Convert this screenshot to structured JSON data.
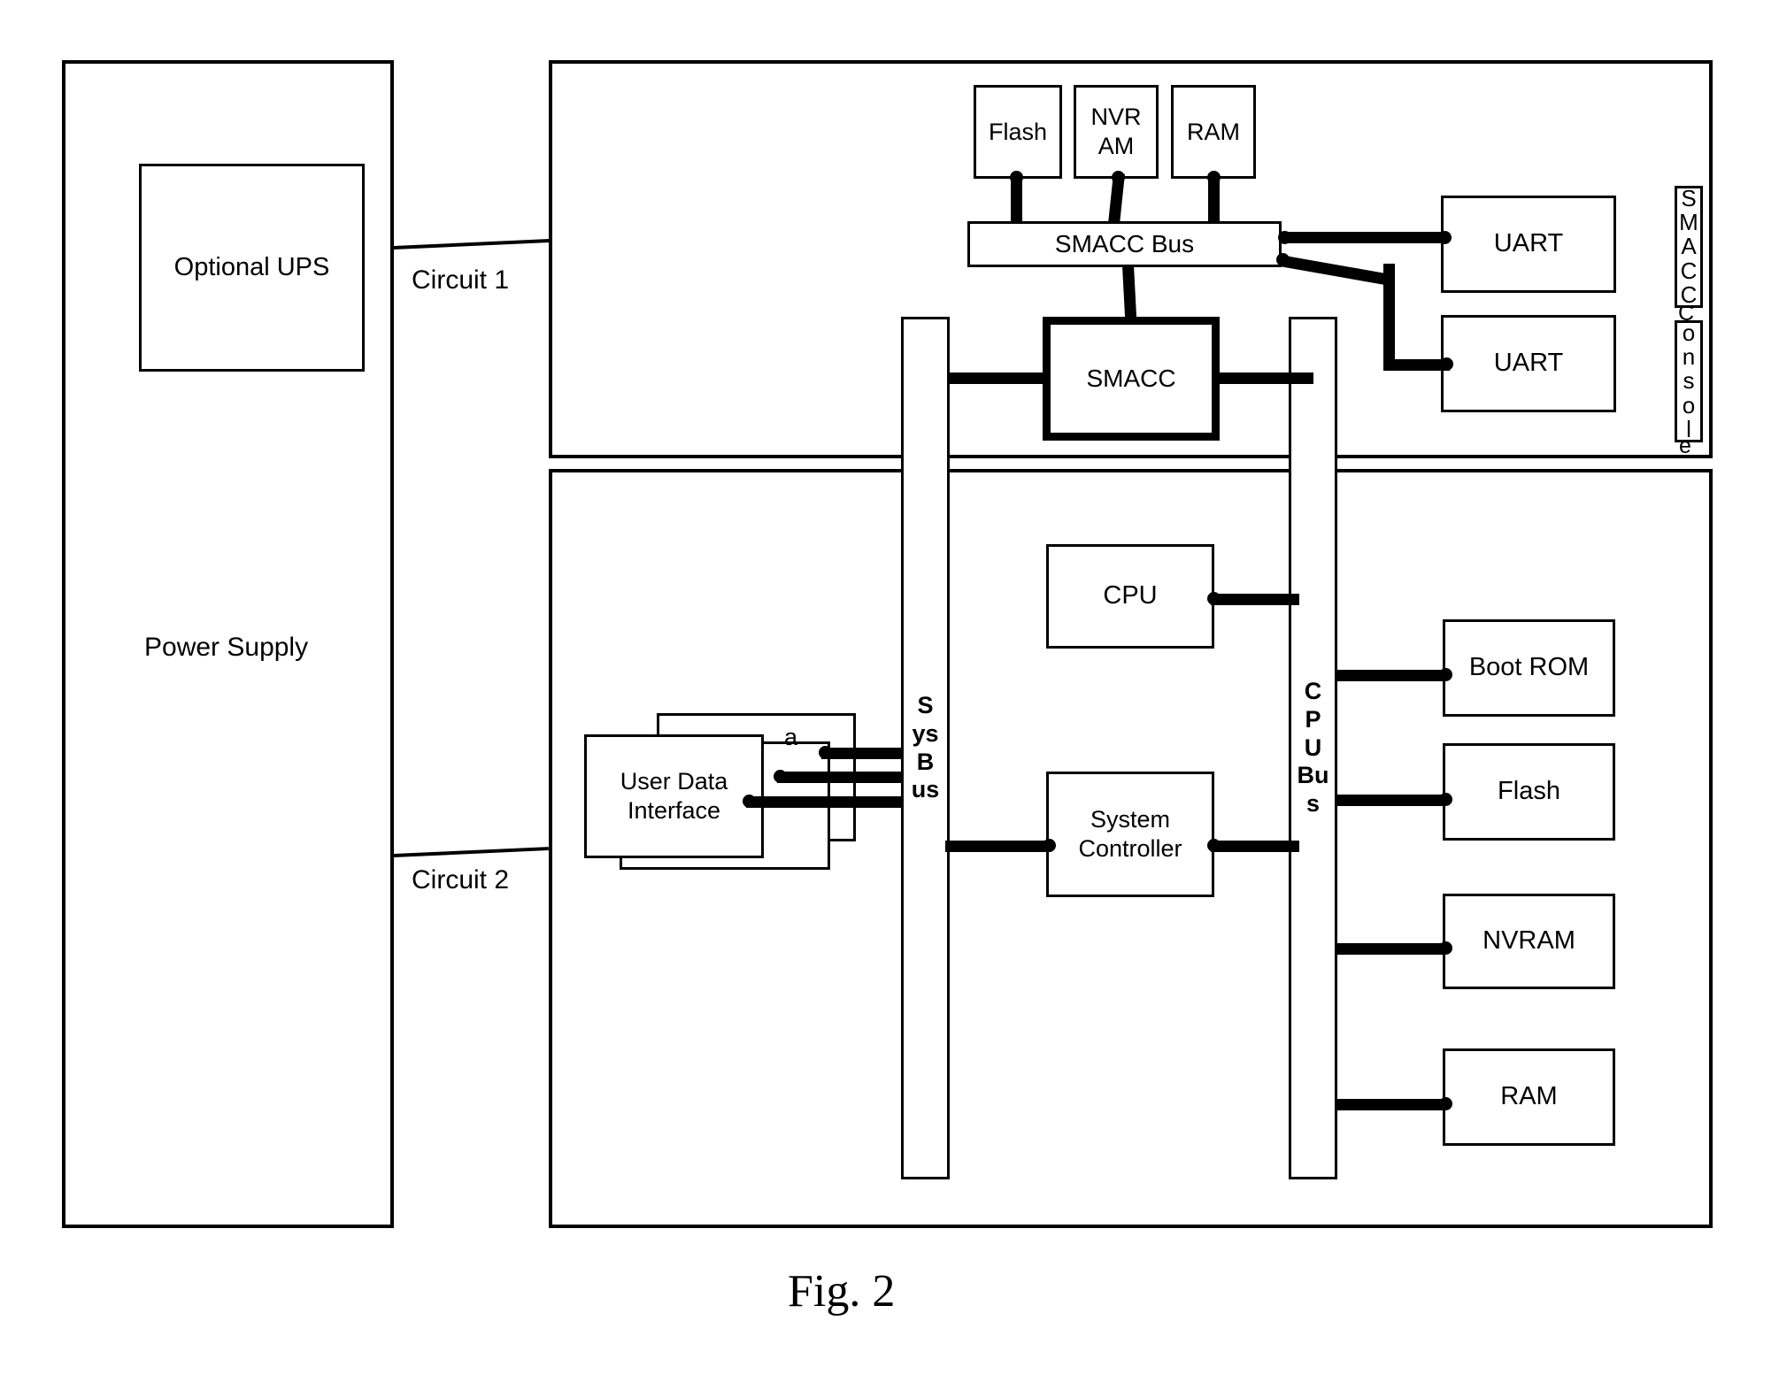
{
  "figure": {
    "caption": "Fig. 2"
  },
  "power_supply": {
    "title": "Power Supply",
    "ups_label": "Optional UPS"
  },
  "connectors": {
    "circuit1_label": "Circuit 1",
    "circuit2_label": "Circuit 2"
  },
  "circuit1": {
    "memories": [
      {
        "label": "Flash"
      },
      {
        "label_line1": "NVR",
        "label_line2": "AM"
      },
      {
        "label": "RAM"
      }
    ],
    "bus_label": "SMACC Bus",
    "controller_label": "SMACC",
    "uarts": [
      {
        "label": "UART"
      },
      {
        "label": "UART"
      }
    ],
    "console_label_part1": [
      "S",
      "M",
      "A",
      "C",
      "C"
    ],
    "console_label_part2": [
      "o",
      "n",
      "s",
      "o",
      "l"
    ],
    "console_overflow_top": "C",
    "console_overflow_bottom": "e",
    "console_full_text": "SMACC Console"
  },
  "circuit2": {
    "user_interface_label_line1": "User Data",
    "user_interface_label_line2": "Interface",
    "hidden_card_letter": "a",
    "sys_bus_label": [
      "S",
      "ys",
      "B",
      "us"
    ],
    "cpu_bus_label": [
      "C",
      "P",
      "U",
      "Bu",
      "s"
    ],
    "cpu_label": "CPU",
    "system_controller_line1": "System",
    "system_controller_line2": "Controller",
    "memories": [
      {
        "label": "Boot ROM"
      },
      {
        "label": "Flash"
      },
      {
        "label": "NVRAM"
      },
      {
        "label": "RAM"
      }
    ]
  },
  "colors": {
    "ink": "#000000",
    "paper": "#ffffff"
  }
}
